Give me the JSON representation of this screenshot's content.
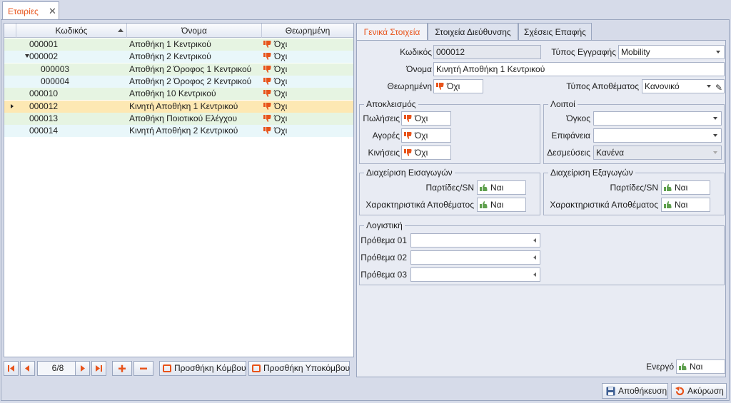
{
  "doc_tab": {
    "title": "Εταιρίες",
    "close": "✕"
  },
  "grid": {
    "headers": {
      "code": "Κωδικός",
      "name": "Όνομα",
      "virtual": "Θεωρημένη"
    },
    "rows": [
      {
        "code": "000001",
        "name": "Αποθήκη 1 Κεντρικού",
        "virtual": "Όχι",
        "bg": "#e6f4e2"
      },
      {
        "code": "000002",
        "name": "Αποθήκη 2 Κεντρικού",
        "virtual": "Όχι",
        "bg": "#e9f7fa"
      },
      {
        "code": "000003",
        "name": "Αποθήκη 2 Όροφος 1 Κεντρικού",
        "virtual": "Όχι",
        "bg": "#e6f4e2"
      },
      {
        "code": "000004",
        "name": "Αποθήκη 2 Όροφος 2 Κεντρικού",
        "virtual": "Όχι",
        "bg": "#e9f7fa"
      },
      {
        "code": "000010",
        "name": "Αποθήκη 10 Κεντρικού",
        "virtual": "Όχι",
        "bg": "#e6f4e2"
      },
      {
        "code": "000012",
        "name": "Κινητή Αποθήκη 1 Κεντρικού",
        "virtual": "Όχι",
        "bg": "#fde8b3"
      },
      {
        "code": "000013",
        "name": "Αποθήκη Ποιοτικού Ελέγχου",
        "virtual": "Όχι",
        "bg": "#e6f4e2"
      },
      {
        "code": "000014",
        "name": "Κινητή Αποθήκη 2 Κεντρικού",
        "virtual": "Όχι",
        "bg": "#e9f7fa"
      }
    ]
  },
  "navigator": {
    "page": "6/8",
    "add_node": "Προσθήκη Κόμβου",
    "add_subnode": "Προσθήκη Υποκόμβου"
  },
  "tabs": [
    "Γενικά Στοιχεία",
    "Στοιχεία Διεύθυνσης",
    "Σχέσεις Επαφής"
  ],
  "general": {
    "code_label": "Κωδικός",
    "code_value": "000012",
    "record_type_label": "Τύπος Εγγραφής",
    "record_type_value": "Mobility",
    "name_label": "Όνομα",
    "name_value": "Κινητή Αποθήκη 1 Κεντρικού",
    "virtual_label": "Θεωρημένη",
    "virtual_value": "Όχι",
    "stock_type_label": "Τύπος Αποθέματος",
    "stock_type_value": "Κανονικό"
  },
  "exclusion": {
    "title": "Αποκλεισμός",
    "sales_label": "Πωλήσεις",
    "sales_value": "Όχι",
    "purchases_label": "Αγορές",
    "purchases_value": "Όχι",
    "movements_label": "Κινήσεις",
    "movements_value": "Όχι"
  },
  "other": {
    "title": "Λοιποί",
    "volume_label": "Όγκος",
    "volume_value": "",
    "surface_label": "Επιφάνεια",
    "surface_value": "",
    "reservations_label": "Δεσμεύσεις",
    "reservations_value": "Κανένα"
  },
  "imports": {
    "title": "Διαχείριση Εισαγωγών",
    "batches_label": "Παρτίδες/SN",
    "batches_value": "Ναι",
    "attrs_label": "Χαρακτηριστικά Αποθέματος",
    "attrs_value": "Ναι"
  },
  "exports": {
    "title": "Διαχείριση Εξαγωγών",
    "batches_label": "Παρτίδες/SN",
    "batches_value": "Ναι",
    "attrs_label": "Χαρακτηριστικά Αποθέματος",
    "attrs_value": "Ναι"
  },
  "accounting": {
    "title": "Λογιστική",
    "prefix1_label": "Πρόθεμα 01",
    "prefix1_value": "",
    "prefix2_label": "Πρόθεμα 02",
    "prefix2_value": "",
    "prefix3_label": "Πρόθεμα 03",
    "prefix3_value": ""
  },
  "active": {
    "label": "Ενεργό",
    "value": "Ναι"
  },
  "buttons": {
    "save": "Αποθήκευση",
    "cancel": "Ακύρωση"
  },
  "colors": {
    "accent": "#e8531a",
    "no_icon": "#e8531a",
    "yes_icon": "#5fa04e"
  }
}
